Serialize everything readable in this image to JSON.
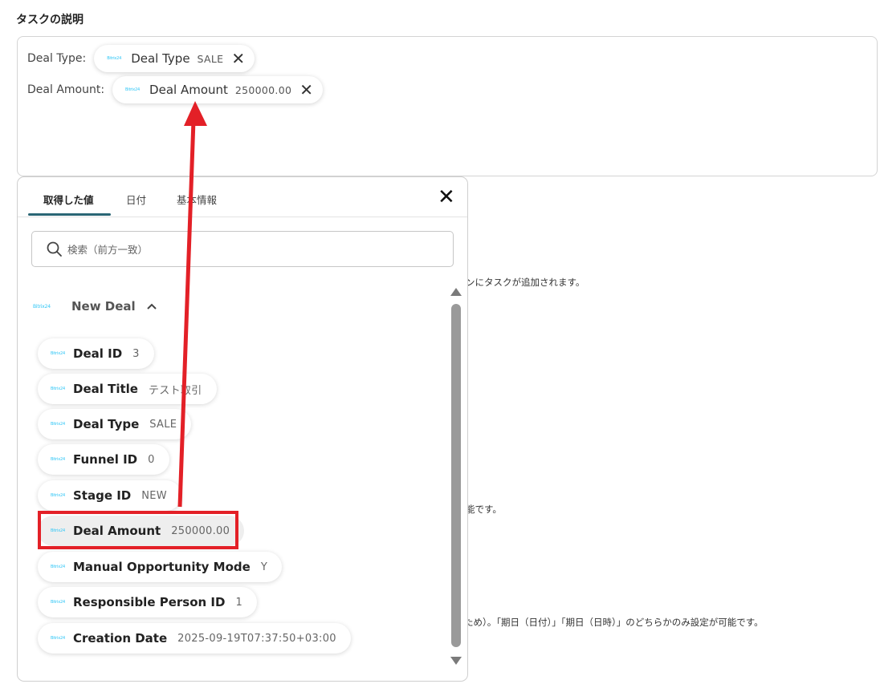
{
  "section_title": "タスクの説明",
  "description": {
    "rows": [
      {
        "label": "Deal Type:",
        "pill": {
          "name": "Deal Type",
          "value": "SALE"
        }
      },
      {
        "label": "Deal Amount:",
        "pill": {
          "name": "Deal Amount",
          "value": "250000.00"
        }
      }
    ]
  },
  "logo_text": "Bitrix24",
  "background_texts": [
    "ンにタスクが追加されます。",
    "能です。",
    "ため）。「期日（日付）」「期日（日時）」のどちらかのみ設定が可能です。"
  ],
  "popup": {
    "tabs": [
      {
        "label": "取得した値",
        "active": true
      },
      {
        "label": "日付",
        "active": false
      },
      {
        "label": "基本情報",
        "active": false
      }
    ],
    "close_symbol": "✕",
    "search_placeholder": "検索（前方一致）",
    "group": {
      "name": "New Deal",
      "logo_text": "Bitrix24",
      "items": [
        {
          "name": "Deal ID",
          "value": "3"
        },
        {
          "name": "Deal Title",
          "value": "テスト取引"
        },
        {
          "name": "Deal Type",
          "value": "SALE"
        },
        {
          "name": "Funnel ID",
          "value": "0"
        },
        {
          "name": "Stage ID",
          "value": "NEW"
        },
        {
          "name": "Deal Amount",
          "value": "250000.00",
          "highlighted": true
        },
        {
          "name": "Manual Opportunity Mode",
          "value": "Y"
        },
        {
          "name": "Responsible Person ID",
          "value": "1"
        },
        {
          "name": "Creation Date",
          "value": "2025-09-19T07:37:50+03:00"
        }
      ]
    }
  },
  "annotation_color": "#e32027"
}
